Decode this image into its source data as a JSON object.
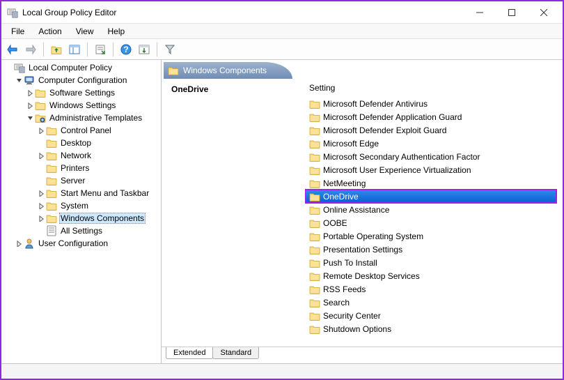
{
  "window": {
    "title": "Local Group Policy Editor"
  },
  "menu": {
    "file": "File",
    "action": "Action",
    "view": "View",
    "help": "Help"
  },
  "tree": {
    "root": "Local Computer Policy",
    "computer_config": "Computer Configuration",
    "software_settings": "Software Settings",
    "windows_settings": "Windows Settings",
    "admin_templates": "Administrative Templates",
    "control_panel": "Control Panel",
    "desktop": "Desktop",
    "network": "Network",
    "printers": "Printers",
    "server": "Server",
    "start_menu": "Start Menu and Taskbar",
    "system": "System",
    "windows_components": "Windows Components",
    "all_settings": "All Settings",
    "user_config": "User Configuration"
  },
  "header": {
    "title": "Windows Components"
  },
  "description": {
    "selected": "OneDrive"
  },
  "list": {
    "header": "Setting",
    "items": [
      "Microsoft Defender Antivirus",
      "Microsoft Defender Application Guard",
      "Microsoft Defender Exploit Guard",
      "Microsoft Edge",
      "Microsoft Secondary Authentication Factor",
      "Microsoft User Experience Virtualization",
      "NetMeeting",
      "OneDrive",
      "Online Assistance",
      "OOBE",
      "Portable Operating System",
      "Presentation Settings",
      "Push To Install",
      "Remote Desktop Services",
      "RSS Feeds",
      "Search",
      "Security Center",
      "Shutdown Options"
    ],
    "highlight_index": 7
  },
  "tabs": {
    "extended": "Extended",
    "standard": "Standard"
  }
}
